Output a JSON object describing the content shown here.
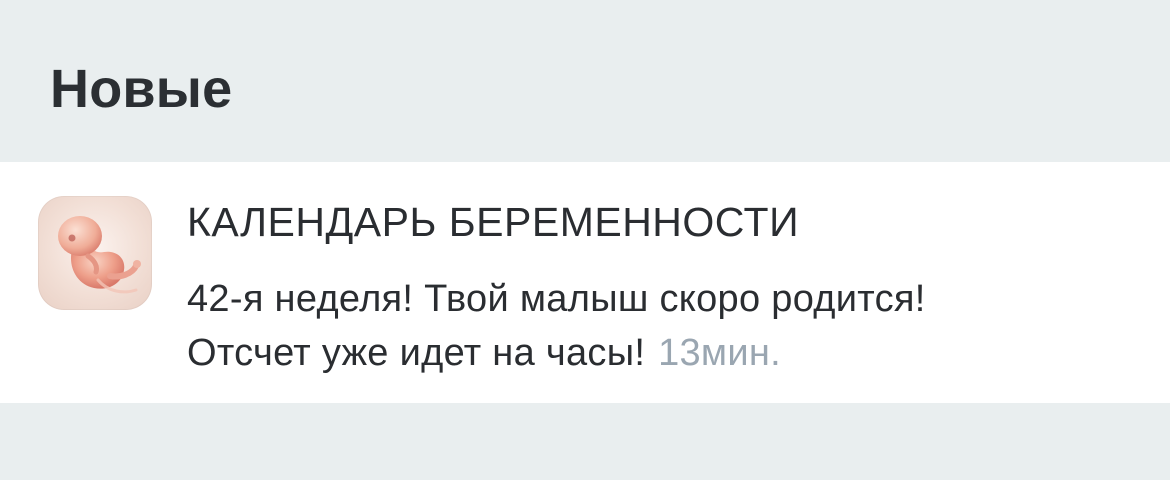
{
  "section": {
    "title": "Новые"
  },
  "notification": {
    "app_name": "КАЛЕНДАРЬ БЕРЕМЕННОСТИ",
    "app_icon": "fetus-icon",
    "message_line1": "42-я неделя! Твой малыш скоро родится!",
    "message_line2": "Отсчет уже идет на часы!",
    "time": "13мин."
  },
  "colors": {
    "background": "#e9eeef",
    "card": "#ffffff",
    "text": "#2a2d31",
    "timestamp": "#9aa6b1"
  }
}
